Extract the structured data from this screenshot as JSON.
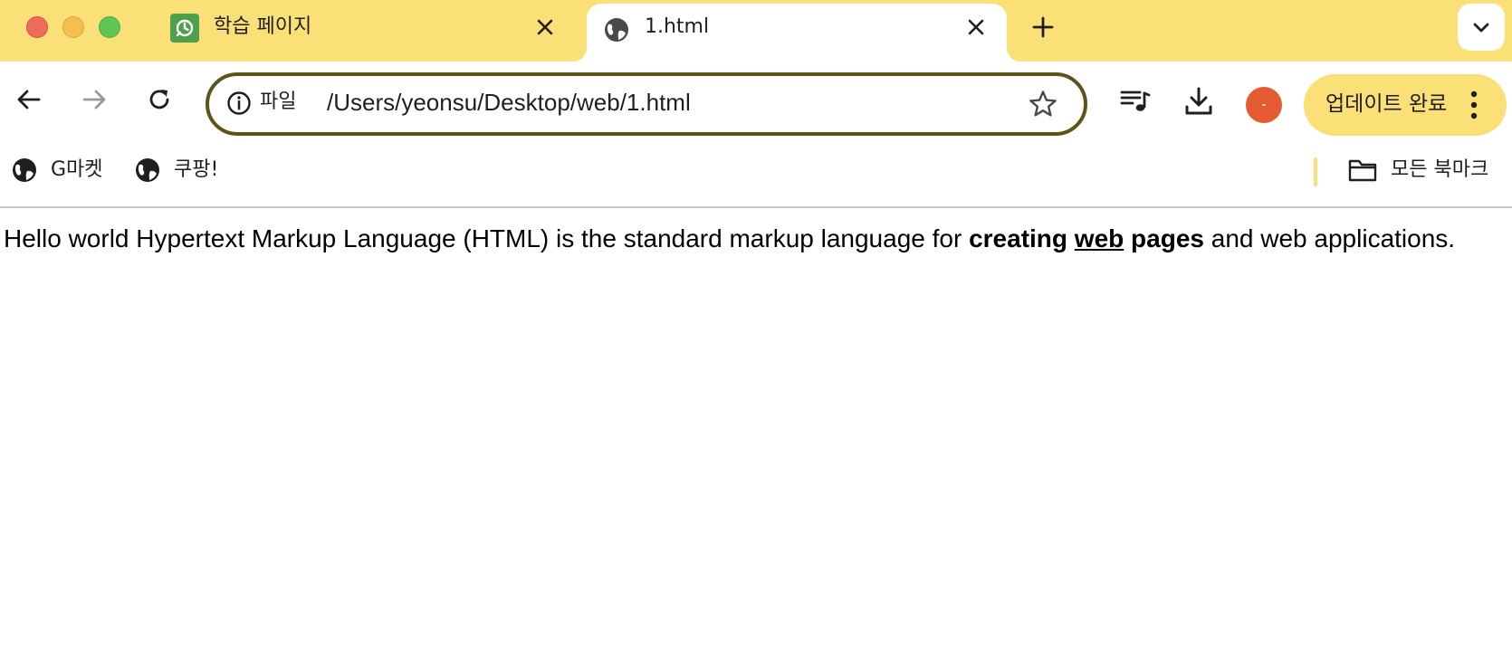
{
  "window": {
    "traffic_lights": [
      "close",
      "minimize",
      "zoom"
    ]
  },
  "tabs": [
    {
      "title": "학습 페이지",
      "active": false,
      "favicon": "learning-app-icon"
    },
    {
      "title": "1.html",
      "active": true,
      "favicon": "globe-icon"
    }
  ],
  "toolbar": {
    "scheme_label": "파일",
    "url": "/Users/yeonsu/Desktop/web/1.html",
    "avatar_initial": "-",
    "update_label": "업데이트 완료"
  },
  "bookmarks": {
    "items": [
      {
        "label": "G마켓",
        "icon": "globe-icon"
      },
      {
        "label": "쿠팡!",
        "icon": "globe-icon"
      }
    ],
    "all_label": "모든 북마크"
  },
  "page": {
    "text_before": "Hello world Hypertext Markup Language (HTML) is the standard markup language for ",
    "bold_1": "creating",
    "bold_underline": "web",
    "bold_2": "pages",
    "text_after": " and web applications."
  },
  "colors": {
    "tabstrip": "#fbe077",
    "omnibox_border": "#5c5418",
    "avatar": "#e55b31"
  }
}
